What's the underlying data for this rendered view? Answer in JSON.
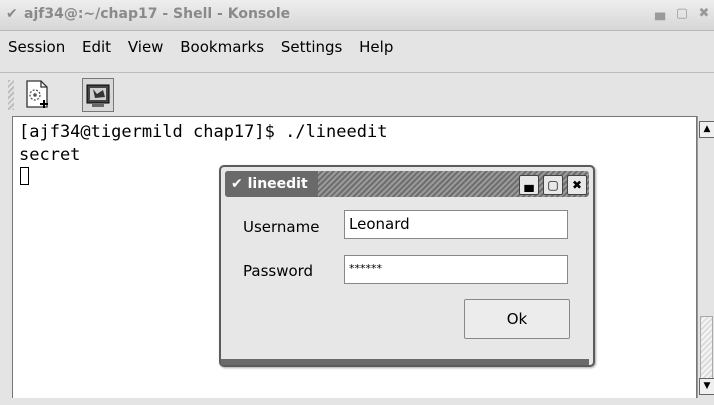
{
  "window": {
    "title": "ajf34@:~/chap17 - Shell - Konsole"
  },
  "menubar": {
    "items": [
      "Session",
      "Edit",
      "View",
      "Bookmarks",
      "Settings",
      "Help"
    ]
  },
  "terminal": {
    "lines": [
      "[ajf34@tigermild chap17]$ ./lineedit",
      "secret"
    ]
  },
  "dialog": {
    "title": "lineedit",
    "username_label": "Username",
    "username_value": "Leonard",
    "password_label": "Password",
    "password_value": "******",
    "ok_label": "Ok"
  }
}
